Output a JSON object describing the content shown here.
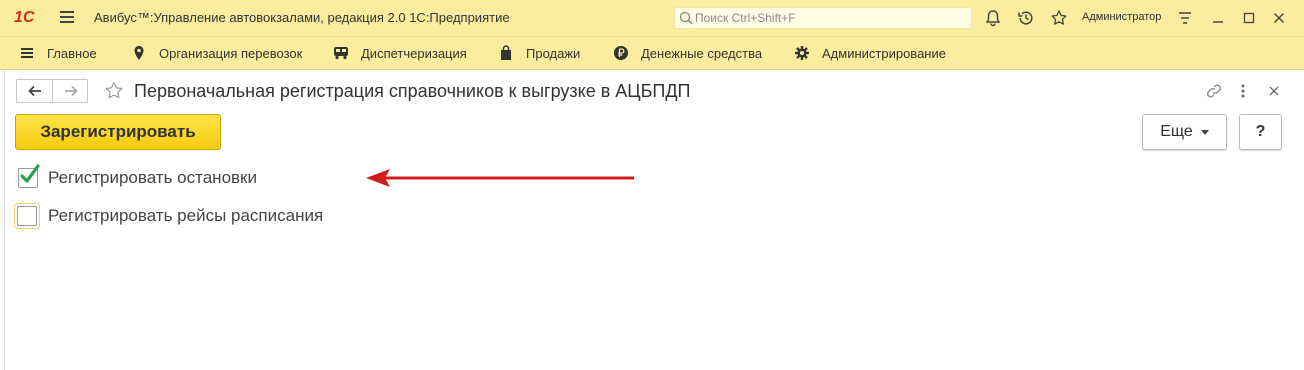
{
  "app": {
    "logo": "1С",
    "title": "Авибус™:Управление автовокзалами, редакция 2.0 1С:Предприятие",
    "search_placeholder": "Поиск Ctrl+Shift+F",
    "user": "Администратор"
  },
  "sections": [
    {
      "label": "Главное",
      "icon": "hamburger-icon"
    },
    {
      "label": "Организация перевозок",
      "icon": "map-pin-icon"
    },
    {
      "label": "Диспетчеризация",
      "icon": "bus-icon"
    },
    {
      "label": "Продажи",
      "icon": "shopping-bag-icon"
    },
    {
      "label": "Денежные средства",
      "icon": "ruble-icon"
    },
    {
      "label": "Администрирование",
      "icon": "gear-icon"
    }
  ],
  "form": {
    "title": "Первоначальная регистрация справочников к выгрузке в АЦБПДП",
    "register_button": "Зарегистрировать",
    "more_button": "Еще",
    "help_button": "?",
    "checkboxes": [
      {
        "label": "Регистрировать остановки",
        "checked": true
      },
      {
        "label": "Регистрировать рейсы расписания",
        "checked": false
      }
    ]
  },
  "colors": {
    "header_bg": "#fbed9e",
    "primary_button": "#f4cb0c",
    "check_mark": "#2e9e4f",
    "annotation_arrow": "#d01c1c"
  }
}
